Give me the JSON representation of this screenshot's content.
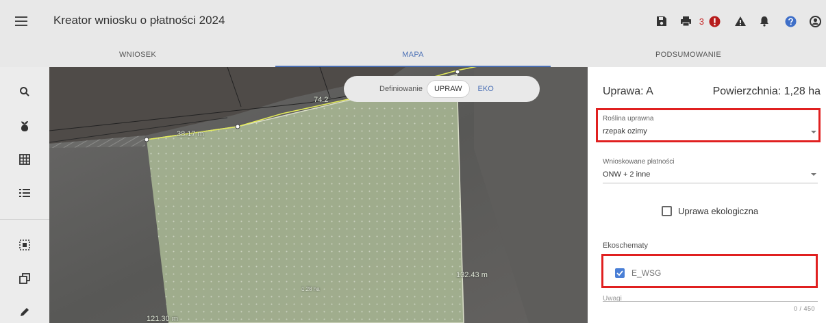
{
  "header": {
    "title": "Kreator wniosku o płatności 2024",
    "error_count": "3"
  },
  "tabs": [
    {
      "label": "WNIOSEK",
      "active": false
    },
    {
      "label": "MAPA",
      "active": true
    },
    {
      "label": "PODSUMOWANIE",
      "active": false
    }
  ],
  "toolbar": {
    "icons": [
      "search-icon",
      "plant-icon",
      "grid-icon",
      "list-icon",
      "select-area-icon",
      "copy-icon",
      "edit-icon"
    ]
  },
  "map": {
    "toggle_label": "Definiowanie",
    "toggle_options": [
      "UPRAW",
      "EKO"
    ],
    "selected_option": "UPRAW",
    "labels": {
      "edge_top": "74.2",
      "edge_left": "38.17 m",
      "edge_right": "132.43 m",
      "area": "1.28 ha",
      "edge_bottom": "121.30 m"
    }
  },
  "panel": {
    "title": "Uprawa: A",
    "area": "Powierzchnia: 1,28 ha",
    "crop_field": {
      "label": "Roślina uprawna",
      "value": "rzepak ozimy"
    },
    "payments_field": {
      "label": "Wnioskowane płatności",
      "value": "ONW + 2 inne"
    },
    "organic_checkbox": {
      "label": "Uprawa ekologiczna",
      "checked": false
    },
    "ecoschemes_header": "Ekoschematy",
    "ecoscheme_items": [
      {
        "label": "E_WSG",
        "checked": true
      }
    ],
    "notes_label": "Uwagi",
    "notes_counter": "0 / 450"
  },
  "colors": {
    "accent": "#4a6fb5",
    "highlight_border": "#e02020",
    "error": "#c62828",
    "help": "#3f6fc8",
    "parcel_fill": "#b9c8a4",
    "parcel_border": "#e7ef7a"
  }
}
